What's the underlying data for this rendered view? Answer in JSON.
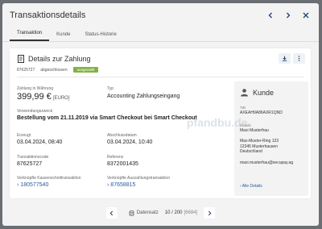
{
  "modal": {
    "title": "Transaktionsdetails",
    "tabs": [
      {
        "label": "Transaktion",
        "active": true
      },
      {
        "label": "Kunde",
        "active": false
      },
      {
        "label": "Status-Historie",
        "active": false
      }
    ]
  },
  "card": {
    "title": "Details zur Zahlung",
    "id": "87625727",
    "status": "abgeschlossen",
    "badge": "ausgezahlt",
    "badge_color": "#7fb342"
  },
  "fields": {
    "amount_label": "Zahlung in Währung",
    "amount": "399,99 €",
    "currency": "[EURO]",
    "type_label": "Typ",
    "type": "Accounting Zahlungseingang",
    "purpose_label": "Verwendungszweck",
    "purpose": "Bestellung vom 21.11.2019 via Smart Checkout bei Smart Checkout",
    "created_label": "Erzeugt",
    "created": "03.04.2024, 08:40",
    "closing_label": "Abschlussdatum",
    "closing": "03.04.2024, 10:40",
    "txcode_label": "Transaktionscode",
    "txcode": "87625727",
    "ref_label": "Referenz",
    "ref": "8372001435",
    "cash_link_label": "Verknüpfte Kassenschnittransaktion",
    "cash_link": "180577540",
    "payout_link_label": "Verknüpfte Auszahlungstransaktion",
    "payout_link": "87658815"
  },
  "customer": {
    "title": "Kunde",
    "tid_label": "TID",
    "tid": "AXEAH9A86AXR1QND",
    "details_label": "Details",
    "name": "Maxi Musterfrau",
    "street": "Max-Muster-Ring 123",
    "city": "12345 Musterhausen",
    "country": "Deutschland",
    "email": "maxi.musterfrau@secupay.ag",
    "all_details": "Alle Details"
  },
  "watermark": "pfandbu.de",
  "pager": {
    "label": "Datensatz",
    "current": "10 / 200",
    "total": "[6684]"
  },
  "icons": [
    "chevron-left-icon",
    "chevron-right-icon",
    "close-icon",
    "receipt-icon",
    "download-icon",
    "more-vert-icon",
    "user-icon",
    "database-icon"
  ]
}
